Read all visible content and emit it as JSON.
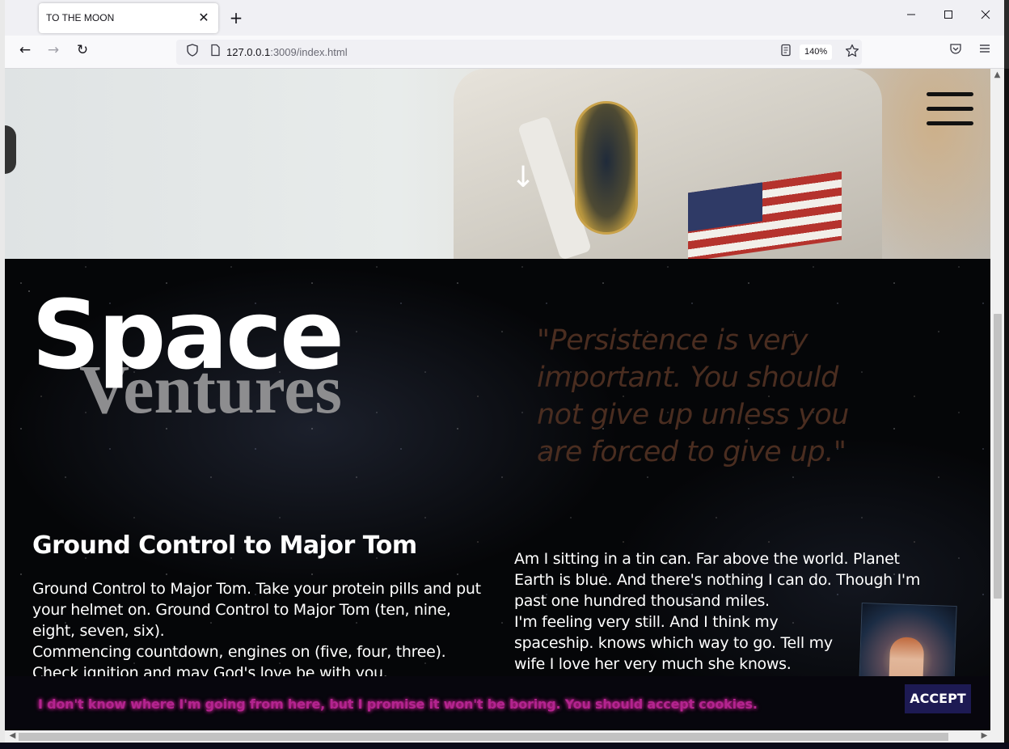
{
  "browser": {
    "tab_title": "TO THE MOON",
    "tab_close": "✕",
    "new_tab": "+",
    "window_controls": {
      "minimize": "—",
      "maximize": "☐",
      "close": "✕"
    },
    "nav": {
      "back": "←",
      "forward": "→",
      "reload": "↻"
    },
    "url_host": "127.0.0.1",
    "url_rest": ":3009/index.html",
    "zoom": "140%",
    "icons": [
      "shield-icon",
      "page-icon",
      "reader-view-icon",
      "bookmark-star-icon",
      "pocket-icon",
      "menu-icon"
    ]
  },
  "hero": {
    "scroll_arrow": "↓"
  },
  "headline": {
    "line1": "Space",
    "line2": "Ventures"
  },
  "quote": "\"Persistence is very important. You should not give up unless you are forced to give up.\"",
  "left_column": {
    "heading": "Ground Control to Major Tom",
    "paragraph1": "Ground Control to Major Tom. Take your protein pills and put your helmet on. Ground Control to Major Tom (ten, nine, eight, seven, six).",
    "paragraph2": "Commencing countdown, engines on (five, four, three). Check ignition and may God's love be with you."
  },
  "right_column": {
    "paragraph": "Am I sitting in a tin can. Far above the world. Planet Earth is blue. And there's nothing I can do. Though I'm past one hundred thousand miles.",
    "paragraph2": "I'm feeling very still. And I think my spaceship. knows which way to go. Tell my wife I love her very much she knows."
  },
  "cookie_banner": {
    "message": "I don't know where I'm going from here, but I promise it won't be boring. You should accept cookies.",
    "accept_label": "ACCEPT"
  },
  "colors": {
    "quote": "#4a2d20",
    "cookie_text": "#b3248f",
    "accept_bg": "#1d1a53",
    "ventures": "#8d8d8f"
  }
}
